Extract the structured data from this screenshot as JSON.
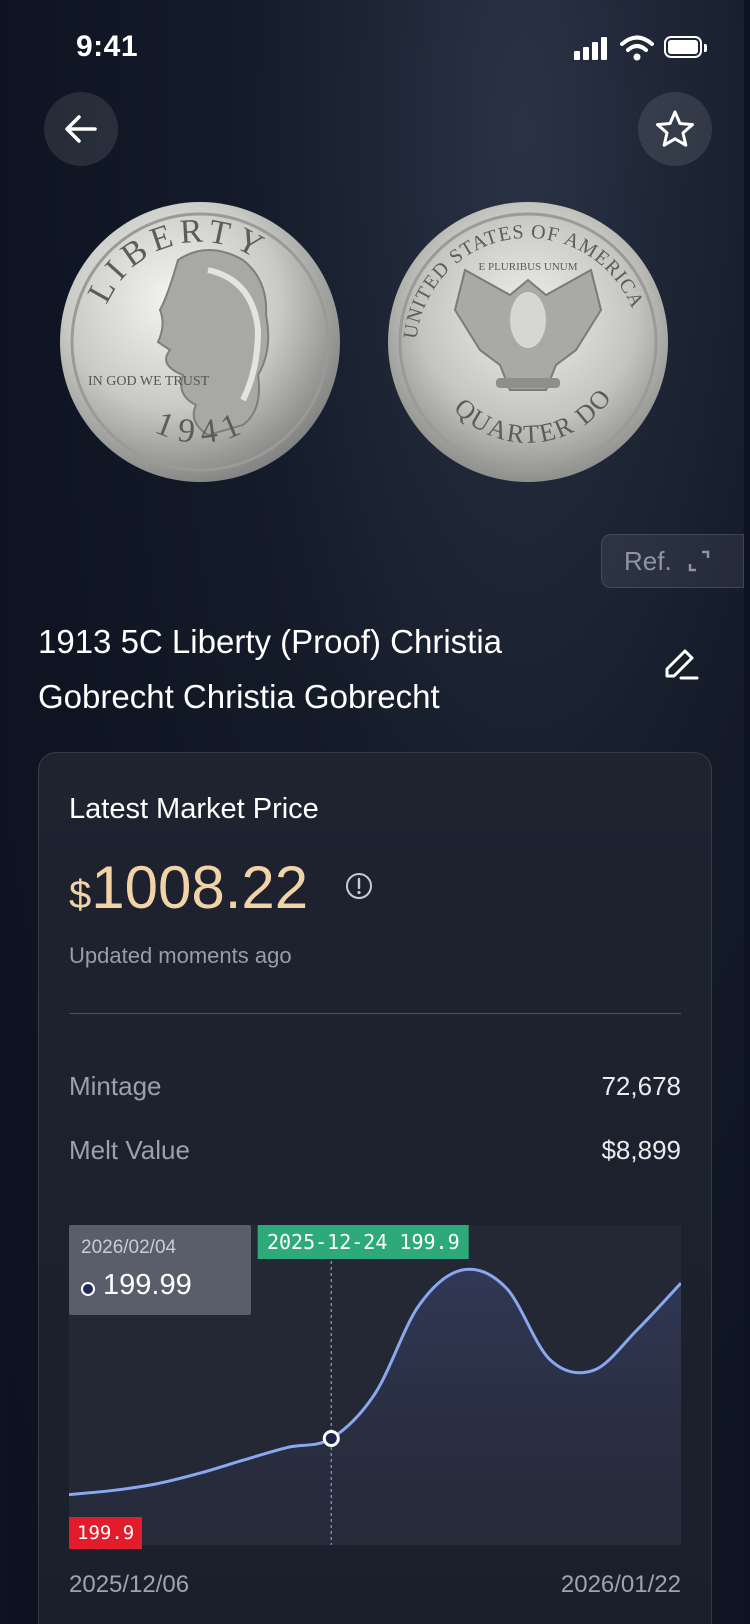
{
  "status_bar": {
    "time": "9:41"
  },
  "nav": {
    "back_icon": "arrow-left-icon",
    "favorite_icon": "star-outline-icon"
  },
  "coin_images": {
    "front": {
      "legend_top": "LIBERTY",
      "motto": "IN GOD WE TRUST",
      "year": "1941"
    },
    "back": {
      "legend_top": "UNITED STATES OF AMERICA",
      "motto": "E PLURIBUS UNUM",
      "denomination": "QUARTER DOLLAR"
    }
  },
  "ref_button": {
    "label": "Ref.",
    "icon": "expand-icon"
  },
  "coin_title": "1913 5C Liberty (Proof) Christia Gobrecht Christia Gobrecht",
  "market": {
    "label": "Latest Market Price",
    "currency": "$",
    "price": "1008.22",
    "updated": "Updated moments ago",
    "info_icon": "info-icon"
  },
  "details": [
    {
      "label": "Mintage",
      "value": "72,678"
    },
    {
      "label": "Melt Value",
      "value": "$8,899"
    }
  ],
  "chart_data": {
    "type": "area",
    "x_start_label": "2025/12/06",
    "x_end_label": "2026/01/22",
    "series": [
      {
        "values": [
          199.9,
          200.6,
          201.7,
          203.5,
          205.7,
          207.8,
          209.3,
          216.8,
          231.5,
          237.5,
          234.5,
          222.5,
          220.7,
          227.5,
          235.3
        ]
      }
    ],
    "ylim": [
      199,
      240
    ],
    "tooltip": {
      "date": "2026/02/04",
      "value": "199.99"
    },
    "crosshair": {
      "index": 6,
      "label": "2025-12-24 199.9"
    },
    "min_label": "199.9",
    "line_color": "#8aa8f0",
    "grid": false
  }
}
